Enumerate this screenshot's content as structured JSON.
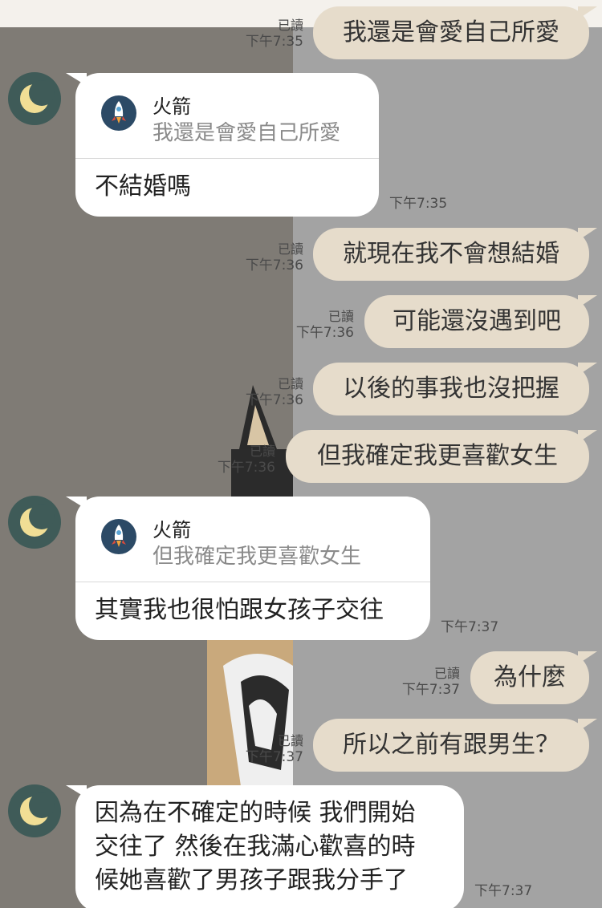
{
  "conversation": {
    "messages": [
      {
        "direction": "out",
        "text": "我還是會愛自己所愛",
        "read": "已讀",
        "time": "下午7:35"
      },
      {
        "direction": "in",
        "reply_to": {
          "name": "火箭",
          "quote": "我還是會愛自己所愛"
        },
        "text": "不結婚嗎",
        "time": "下午7:35"
      },
      {
        "direction": "out",
        "text": "就現在我不會想結婚",
        "read": "已讀",
        "time": "下午7:36"
      },
      {
        "direction": "out",
        "text": "可能還沒遇到吧",
        "read": "已讀",
        "time": "下午7:36"
      },
      {
        "direction": "out",
        "text": "以後的事我也沒把握",
        "read": "已讀",
        "time": "下午7:36"
      },
      {
        "direction": "out",
        "text": "但我確定我更喜歡女生",
        "read": "已讀",
        "time": "下午7:36"
      },
      {
        "direction": "in",
        "reply_to": {
          "name": "火箭",
          "quote": "但我確定我更喜歡女生"
        },
        "text": "其實我也很怕跟女孩子交往",
        "time": "下午7:37"
      },
      {
        "direction": "out",
        "text": "為什麼",
        "read": "已讀",
        "time": "下午7:37"
      },
      {
        "direction": "out",
        "text": "所以之前有跟男生？",
        "read": "已讀",
        "time": "下午7:37"
      },
      {
        "direction": "in",
        "lines": [
          "因為在不確定的時候 我們開始",
          "交往了 然後在我滿心歡喜的時",
          "候她喜歡了男孩子跟我分手了"
        ],
        "time": "下午7:37"
      }
    ]
  },
  "icons": {
    "avatar": "crescent-moon-icon",
    "reply": "rocket-icon"
  },
  "colors": {
    "outgoing_bubble": "#e6dccb",
    "incoming_bubble": "#ffffff",
    "avatar_bg": "#3f5b58",
    "moon": "#f1de95",
    "background_left": "#7f7b75",
    "background_right": "#a3a3a3"
  }
}
